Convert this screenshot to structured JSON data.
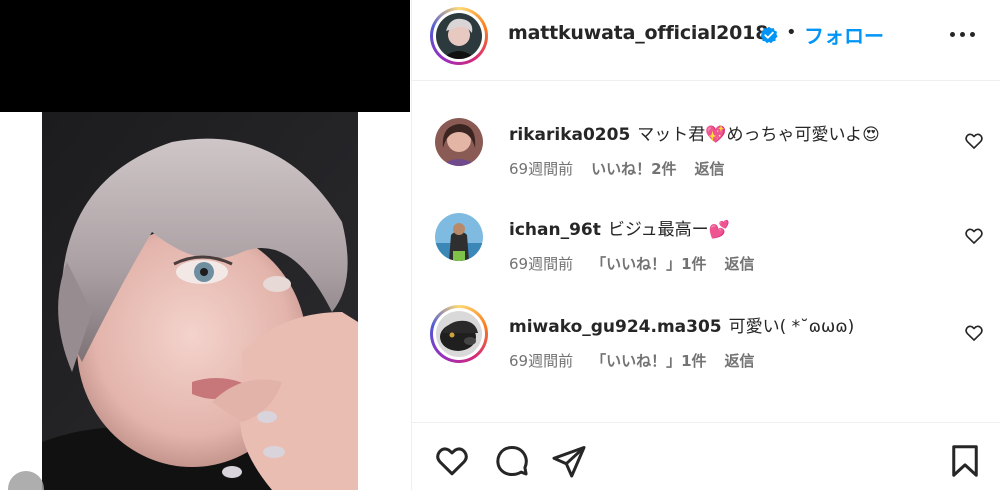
{
  "post": {
    "owner": {
      "username": "mattkuwata_official2018",
      "verified": true,
      "avatar_icon": "profile-photo"
    },
    "separator": "•",
    "follow_label": "フォロー",
    "more_icon": "more-horizontal-icon"
  },
  "comments": [
    {
      "username": "rikarika0205",
      "text": "マット君💖めっちゃ可愛いよ😍",
      "time": "69週間前",
      "likes": "いいね！2件",
      "reply": "返信",
      "has_story_ring": false,
      "avatar_color": "#7a4e4e"
    },
    {
      "username": "ichan_96t",
      "text": "ビジュ最高ー💕",
      "time": "69週間前",
      "likes": "「いいね！」1件",
      "reply": "返信",
      "has_story_ring": false,
      "avatar_color": "#5a9fc8"
    },
    {
      "username": "miwako_gu924.ma305",
      "text": "可愛い( *˘ɷωɷ)",
      "time": "69週間前",
      "likes": "「いいね！」1件",
      "reply": "返信",
      "has_story_ring": true,
      "avatar_color": "#2b2b2b"
    }
  ],
  "actions": {
    "like_icon": "heart-icon",
    "comment_icon": "comment-icon",
    "share_icon": "share-icon",
    "save_icon": "bookmark-icon"
  },
  "colors": {
    "accent": "#0095f6",
    "verified": "#0095f6",
    "text": "#262626",
    "muted": "#737373",
    "divider": "#efefef"
  }
}
